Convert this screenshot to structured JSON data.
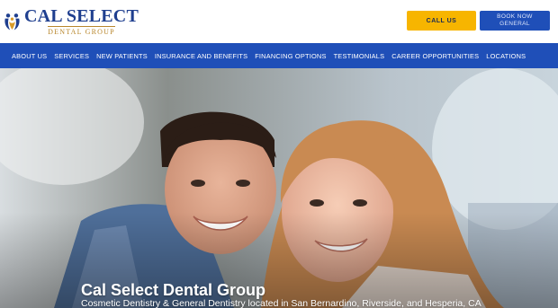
{
  "header": {
    "logo": {
      "title": "CAL SELECT",
      "subtitle": "DENTAL GROUP",
      "icon": "tooth-family-logo-icon"
    },
    "call_button": "CALL US",
    "book_button": {
      "line1": "BOOK NOW",
      "line2": "GENERAL"
    }
  },
  "nav": {
    "items": [
      "ABOUT US",
      "SERVICES",
      "NEW PATIENTS",
      "INSURANCE AND BENEFITS",
      "FINANCING OPTIONS",
      "TESTIMONIALS",
      "CAREER OPPORTUNITIES",
      "LOCATIONS"
    ]
  },
  "hero": {
    "title": "Cal Select Dental Group",
    "subtitle": "Cosmetic Dentistry & General Dentistry located in San Bernardino, Riverside, and Hesperia, CA",
    "image": "smiling-couple-photo"
  },
  "colors": {
    "brand_blue": "#1f4fb8",
    "call_yellow": "#f7b500",
    "logo_gold": "#b8862b"
  }
}
